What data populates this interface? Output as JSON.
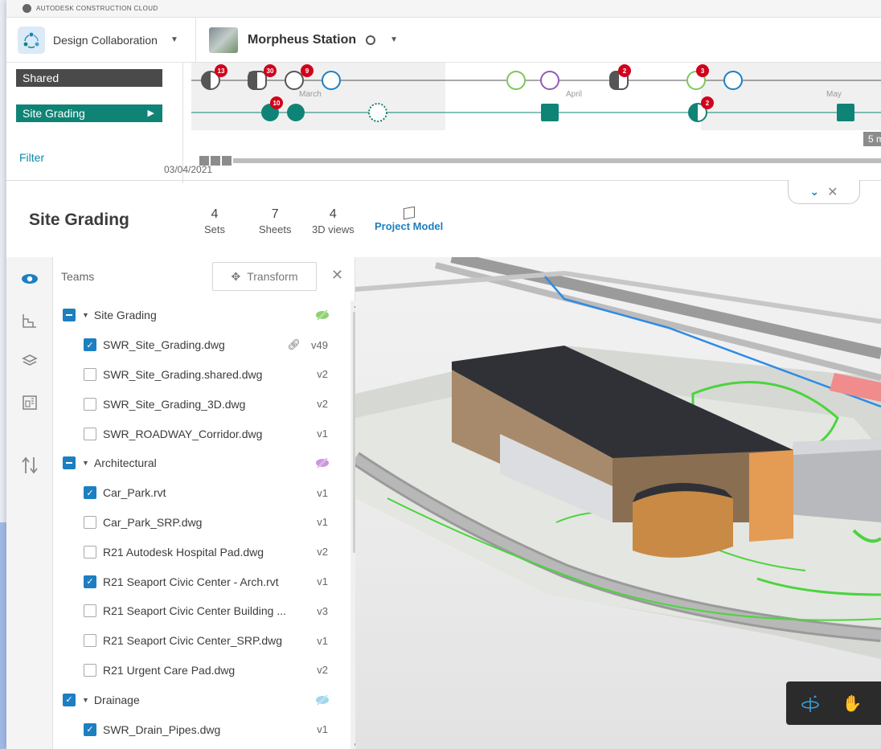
{
  "brand": {
    "text": "AUTODESK CONSTRUCTION CLOUD"
  },
  "header": {
    "app_name": "Design Collaboration",
    "project_name": "Morpheus Station"
  },
  "timeline": {
    "rows": [
      {
        "label": "Shared"
      },
      {
        "label": "Site Grading"
      }
    ],
    "filter_label": "Filter",
    "months": [
      "March",
      "April",
      "May"
    ],
    "badges": [
      "13",
      "30",
      "9",
      "2",
      "3",
      "10",
      "2"
    ],
    "date": "03/04/2021",
    "zoom_label": "5 m"
  },
  "info": {
    "title": "Site Grading",
    "stats": [
      {
        "num": "4",
        "label": "Sets"
      },
      {
        "num": "7",
        "label": "Sheets"
      },
      {
        "num": "4",
        "label": "3D views"
      }
    ],
    "project_model_label": "Project Model"
  },
  "panel": {
    "title": "Teams",
    "transform_label": "Transform",
    "groups": [
      {
        "name": "Site Grading",
        "eye_color": "#7dc75a",
        "files": [
          {
            "name": "SWR_Site_Grading.dwg",
            "version": "v49",
            "checked": true,
            "linked": true
          },
          {
            "name": "SWR_Site_Grading.shared.dwg",
            "version": "v2",
            "checked": false
          },
          {
            "name": "SWR_Site_Grading_3D.dwg",
            "version": "v2",
            "checked": false
          },
          {
            "name": "SWR_ROADWAY_Corridor.dwg",
            "version": "v1",
            "checked": false
          }
        ]
      },
      {
        "name": "Architectural",
        "eye_color": "#c184d6",
        "files": [
          {
            "name": "Car_Park.rvt",
            "version": "v1",
            "checked": true
          },
          {
            "name": "Car_Park_SRP.dwg",
            "version": "v1",
            "checked": false
          },
          {
            "name": "R21 Autodesk Hospital Pad.dwg",
            "version": "v2",
            "checked": false
          },
          {
            "name": "R21 Seaport Civic Center - Arch.rvt",
            "version": "v1",
            "checked": true
          },
          {
            "name": "R21 Seaport Civic Center Building ...",
            "version": "v3",
            "checked": false
          },
          {
            "name": "R21 Seaport Civic Center_SRP.dwg",
            "version": "v1",
            "checked": false
          },
          {
            "name": "R21 Urgent Care Pad.dwg",
            "version": "v2",
            "checked": false
          }
        ]
      },
      {
        "name": "Drainage",
        "eye_color": "#8fd0ea",
        "files": [
          {
            "name": "SWR_Drain_Pipes.dwg",
            "version": "v1",
            "checked": true
          }
        ]
      }
    ]
  },
  "colors": {
    "teal": "#0f8476",
    "accent_blue": "#1c7fc2",
    "shared_dark": "#4a4a4a",
    "badge_red": "#d0021b"
  }
}
